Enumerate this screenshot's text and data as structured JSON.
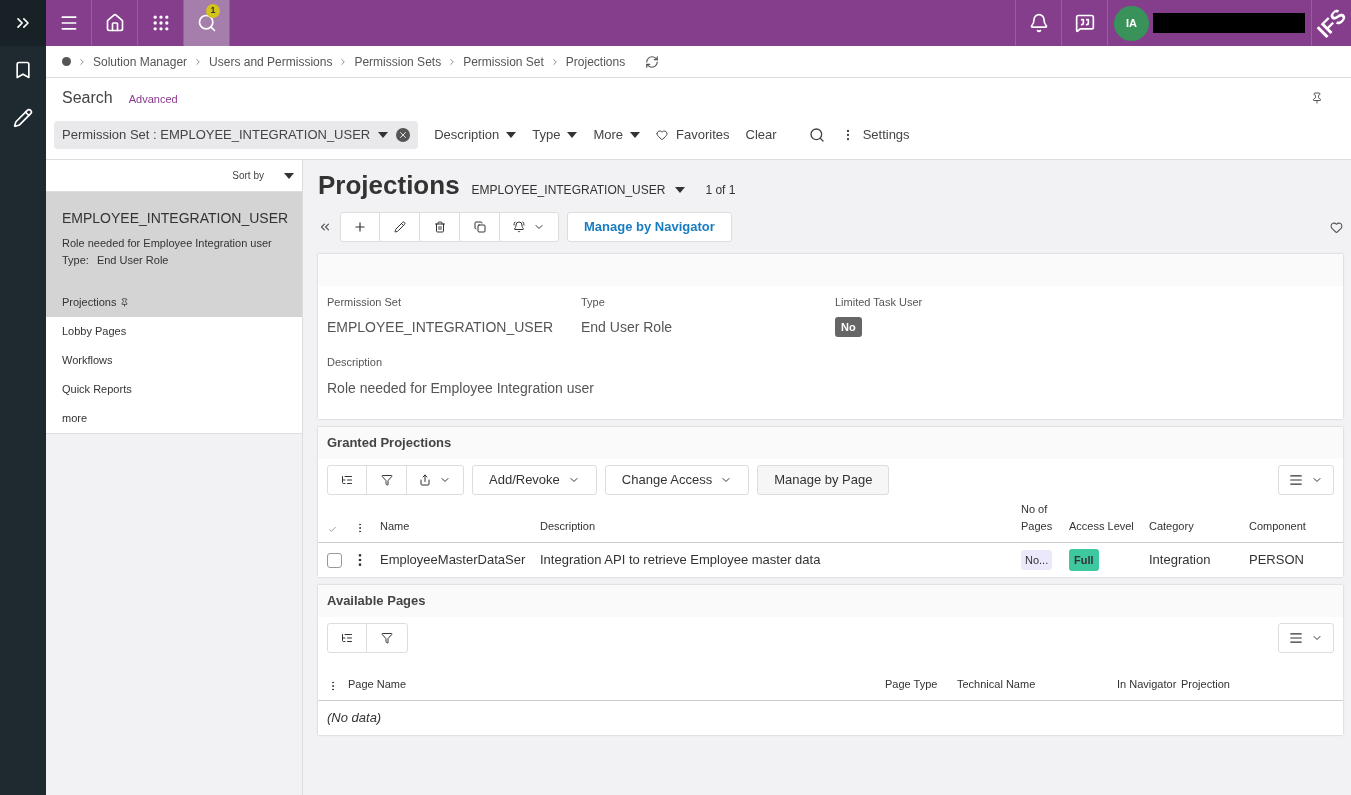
{
  "top_bar": {
    "nav_buttons": [
      {
        "kind": "menu",
        "selected": false
      },
      {
        "kind": "home",
        "selected": false
      },
      {
        "kind": "apps",
        "selected": false
      },
      {
        "kind": "search",
        "selected": true,
        "badge": "1"
      }
    ],
    "avatar_initials": "IA",
    "logo": "IFS"
  },
  "breadcrumb": [
    "Solution Manager",
    "Users and Permissions",
    "Permission Sets",
    "Permission Set",
    "Projections"
  ],
  "search": {
    "title": "Search",
    "advanced": "Advanced",
    "chip": "Permission Set : EMPLOYEE_INTEGRATION_USER",
    "filters": [
      "Description",
      "Type",
      "More"
    ],
    "favorites": "Favorites",
    "clear": "Clear",
    "settings": "Settings"
  },
  "list_panel": {
    "sort_by": "Sort by",
    "record": {
      "title": "EMPLOYEE_INTEGRATION_USER",
      "description": "Role needed for Employee Integration user",
      "type_label": "Type:",
      "type_value": "End User Role"
    },
    "links": [
      {
        "label": "Projections",
        "selected": true,
        "pinned": true
      },
      {
        "label": "Lobby Pages",
        "selected": false,
        "pinned": false
      },
      {
        "label": "Workflows",
        "selected": false,
        "pinned": false
      },
      {
        "label": "Quick Reports",
        "selected": false,
        "pinned": false
      },
      {
        "label": "more",
        "selected": false,
        "pinned": false
      }
    ]
  },
  "page": {
    "title": "Projections",
    "record_selector": "EMPLOYEE_INTEGRATION_USER",
    "counter": "1 of 1",
    "primary_action": "Manage by Navigator"
  },
  "details": {
    "fields": [
      {
        "label": "Permission Set",
        "value": "EMPLOYEE_INTEGRATION_USER",
        "kind": "text"
      },
      {
        "label": "Type",
        "value": "End User Role",
        "kind": "text"
      },
      {
        "label": "Limited Task User",
        "value": "No",
        "kind": "badge"
      }
    ],
    "description": {
      "label": "Description",
      "value": "Role needed for Employee Integration user"
    }
  },
  "granted": {
    "title": "Granted Projections",
    "actions": [
      "Add/Revoke",
      "Change Access"
    ],
    "manage": "Manage by Page",
    "columns": [
      "Name",
      "Description",
      "No of Pages",
      "Access Level",
      "Category",
      "Component"
    ],
    "rows": [
      {
        "checked": false,
        "name": "EmployeeMasterDataSer",
        "description": "Integration API to retrieve Employee master data",
        "pages": "No...",
        "access": "Full",
        "category": "Integration",
        "component": "PERSON"
      }
    ]
  },
  "available": {
    "title": "Available Pages",
    "columns": [
      "Page Name",
      "Page Type",
      "Technical Name",
      "In Navigator",
      "Projection"
    ],
    "empty": "(No data)"
  }
}
